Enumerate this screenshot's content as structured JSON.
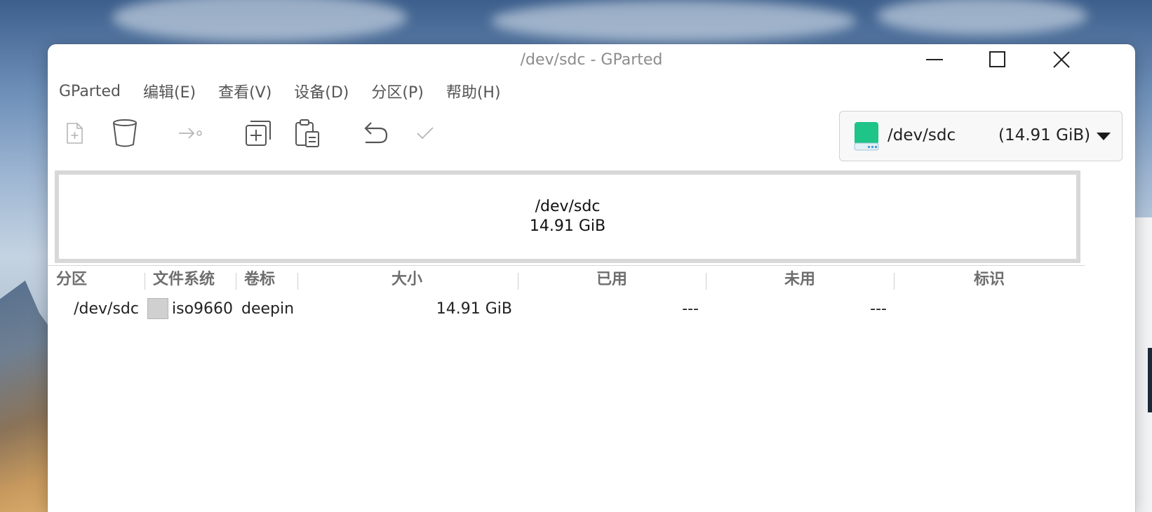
{
  "window": {
    "title": "/dev/sdc - GParted"
  },
  "menubar": {
    "items": [
      "GParted",
      "编辑(E)",
      "查看(V)",
      "设备(D)",
      "分区(P)",
      "帮助(H)"
    ]
  },
  "toolbar": {
    "tools": [
      {
        "icon": "new-partition-icon",
        "enabled": false
      },
      {
        "icon": "delete-icon",
        "enabled": true
      },
      {
        "icon": "resize-move-icon",
        "enabled": false
      },
      {
        "icon": "copy-icon",
        "enabled": true
      },
      {
        "icon": "paste-icon",
        "enabled": true
      },
      {
        "icon": "undo-icon",
        "enabled": true
      },
      {
        "icon": "apply-icon",
        "enabled": false
      }
    ]
  },
  "device_selector": {
    "name": "/dev/sdc",
    "size": "(14.91 GiB)",
    "icon": "drive-icon",
    "icon_color": "#1ec488"
  },
  "disk_map": {
    "name": "/dev/sdc",
    "size": "14.91 GiB"
  },
  "columns": [
    "分区",
    "文件系统",
    "卷标",
    "大小",
    "已用",
    "未用",
    "标识"
  ],
  "partitions": [
    {
      "partition": "/dev/sdc",
      "filesystem": "iso9660",
      "fs_color": "#d0d0d0",
      "label": "deepin",
      "size": "14.91 GiB",
      "used": "---",
      "unused": "---",
      "flags": ""
    }
  ]
}
